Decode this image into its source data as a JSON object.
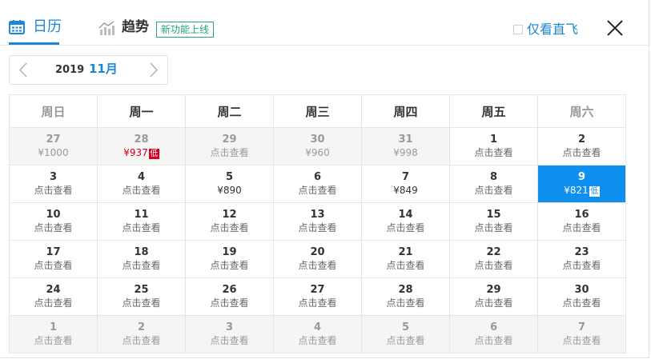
{
  "tabs": {
    "calendar_label": "日历",
    "trend_label": "趋势",
    "new_feature_badge": "新功能上线"
  },
  "filters": {
    "direct_only_label": "仅看直飞"
  },
  "month_selector": {
    "year": "2019",
    "month": "11月"
  },
  "colors": {
    "accent": "#1a87d7",
    "selected": "#0f8ff0",
    "lowest_price": "#d6001c",
    "badge": "#21a679"
  },
  "calendar": {
    "weekdays": [
      "周日",
      "周一",
      "周二",
      "周三",
      "周四",
      "周五",
      "周六"
    ],
    "low_tag": "低",
    "weeks": [
      [
        {
          "day": "27",
          "text": "¥1000",
          "other_month": true
        },
        {
          "day": "28",
          "text": "¥937",
          "other_month": true,
          "lowest": true
        },
        {
          "day": "29",
          "text": "点击查看",
          "other_month": true
        },
        {
          "day": "30",
          "text": "¥960",
          "other_month": true
        },
        {
          "day": "31",
          "text": "¥998",
          "other_month": true
        },
        {
          "day": "1",
          "text": "点击查看"
        },
        {
          "day": "2",
          "text": "点击查看"
        }
      ],
      [
        {
          "day": "3",
          "text": "点击查看"
        },
        {
          "day": "4",
          "text": "点击查看"
        },
        {
          "day": "5",
          "text": "¥890",
          "price": true
        },
        {
          "day": "6",
          "text": "点击查看"
        },
        {
          "day": "7",
          "text": "¥849",
          "price": true
        },
        {
          "day": "8",
          "text": "点击查看"
        },
        {
          "day": "9",
          "text": "¥821",
          "selected": true,
          "lowest": true
        }
      ],
      [
        {
          "day": "10",
          "text": "点击查看"
        },
        {
          "day": "11",
          "text": "点击查看"
        },
        {
          "day": "12",
          "text": "点击查看"
        },
        {
          "day": "13",
          "text": "点击查看"
        },
        {
          "day": "14",
          "text": "点击查看"
        },
        {
          "day": "15",
          "text": "点击查看"
        },
        {
          "day": "16",
          "text": "点击查看"
        }
      ],
      [
        {
          "day": "17",
          "text": "点击查看"
        },
        {
          "day": "18",
          "text": "点击查看"
        },
        {
          "day": "19",
          "text": "点击查看"
        },
        {
          "day": "20",
          "text": "点击查看"
        },
        {
          "day": "21",
          "text": "点击查看"
        },
        {
          "day": "22",
          "text": "点击查看"
        },
        {
          "day": "23",
          "text": "点击查看"
        }
      ],
      [
        {
          "day": "24",
          "text": "点击查看"
        },
        {
          "day": "25",
          "text": "点击查看"
        },
        {
          "day": "26",
          "text": "点击查看"
        },
        {
          "day": "27",
          "text": "点击查看"
        },
        {
          "day": "28",
          "text": "点击查看"
        },
        {
          "day": "29",
          "text": "点击查看"
        },
        {
          "day": "30",
          "text": "点击查看"
        }
      ],
      [
        {
          "day": "1",
          "text": "点击查看",
          "other_month": true
        },
        {
          "day": "2",
          "text": "点击查看",
          "other_month": true
        },
        {
          "day": "3",
          "text": "点击查看",
          "other_month": true
        },
        {
          "day": "4",
          "text": "点击查看",
          "other_month": true
        },
        {
          "day": "5",
          "text": "点击查看",
          "other_month": true
        },
        {
          "day": "6",
          "text": "点击查看",
          "other_month": true
        },
        {
          "day": "7",
          "text": "点击查看",
          "other_month": true
        }
      ]
    ]
  },
  "icons": {
    "calendar_tab": "calendar-icon",
    "trend_tab": "trend-chart-icon",
    "close": "close-icon",
    "prev": "chevron-left-icon",
    "next": "chevron-right-icon"
  }
}
